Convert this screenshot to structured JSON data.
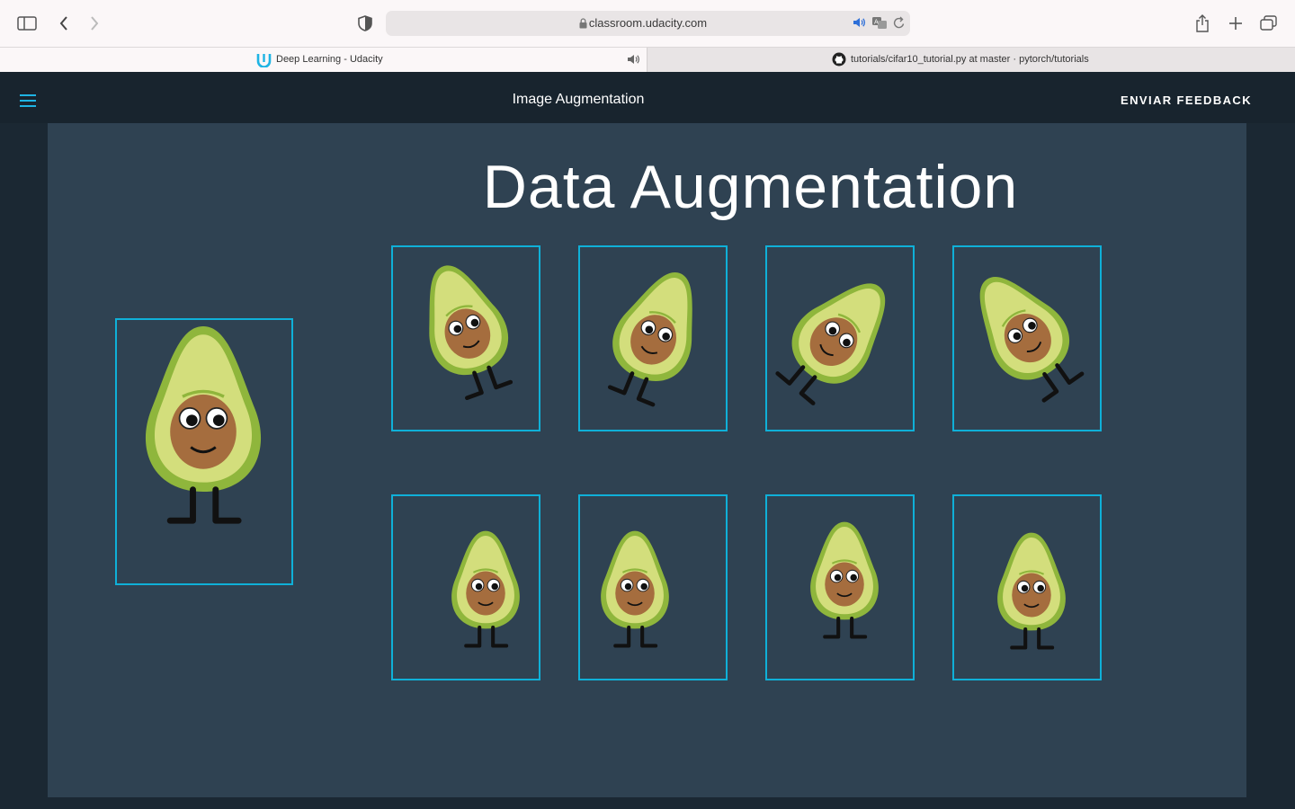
{
  "browser": {
    "url": "classroom.udacity.com",
    "tabs": [
      {
        "label": "Deep Learning - Udacity",
        "active": true
      },
      {
        "label": "tutorials/cifar10_tutorial.py at master · pytorch/tutorials",
        "active": false
      }
    ],
    "icons": [
      "sidebar-icon",
      "back-icon",
      "forward-icon",
      "shield-icon",
      "lock-icon",
      "speaker-icon",
      "translate-icon",
      "reload-icon",
      "share-icon",
      "new-tab-icon",
      "tabs-overview-icon",
      "udacity-logo-icon",
      "github-icon"
    ]
  },
  "app": {
    "title": "Image Augmentation",
    "feedback_label": "ENVIAR FEEDBACK",
    "menu_icon": "hamburger-icon"
  },
  "slide": {
    "title": "Data Augmentation",
    "frame_color": "#0fb0d8",
    "background": "#2f4252",
    "augmented_images": 8
  }
}
